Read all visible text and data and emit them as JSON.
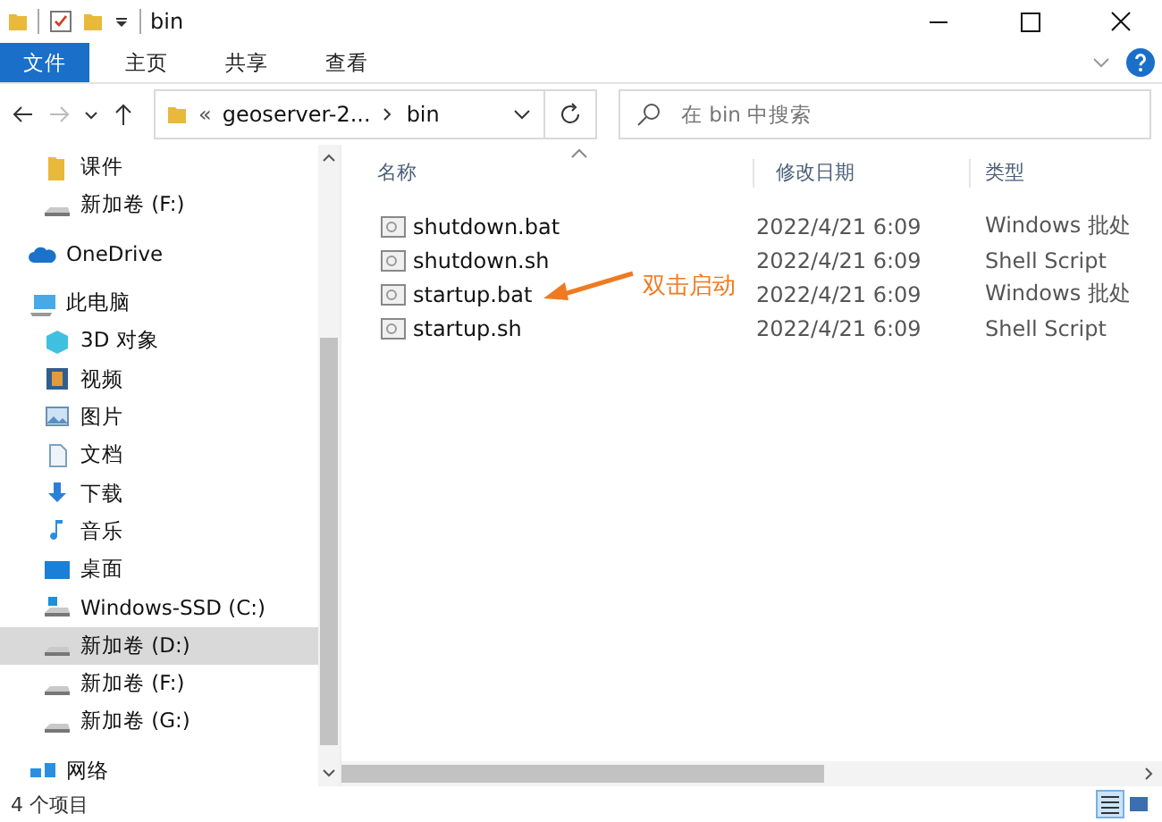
{
  "window": {
    "title": "bin"
  },
  "ribbon_tabs": [
    {
      "label": "文件",
      "selected": true
    },
    {
      "label": "主页",
      "selected": false
    },
    {
      "label": "共享",
      "selected": false
    },
    {
      "label": "查看",
      "selected": false
    }
  ],
  "address_bar": {
    "overflow": "«",
    "path": [
      "geoserver-2...",
      "bin"
    ],
    "forward_disabled": true
  },
  "search": {
    "placeholder": "在 bin 中搜索"
  },
  "nav_pane": {
    "quick_access": [
      {
        "label": "课件",
        "kind": "folder",
        "selected": false
      },
      {
        "label": "新加卷 (F:)",
        "kind": "drive",
        "selected": false
      }
    ],
    "items": [
      {
        "label": "OneDrive",
        "kind": "cloud",
        "selected": false
      },
      {
        "label": "此电脑",
        "kind": "pc",
        "selected": false,
        "children": [
          {
            "label": "3D 对象",
            "kind": "cube",
            "selected": false
          },
          {
            "label": "视频",
            "kind": "video",
            "selected": false
          },
          {
            "label": "图片",
            "kind": "image",
            "selected": false
          },
          {
            "label": "文档",
            "kind": "doc",
            "selected": false
          },
          {
            "label": "下载",
            "kind": "download",
            "selected": false
          },
          {
            "label": "音乐",
            "kind": "music",
            "selected": false
          },
          {
            "label": "桌面",
            "kind": "desktop",
            "selected": false
          },
          {
            "label": "Windows-SSD (C:)",
            "kind": "sysdrive",
            "selected": false
          },
          {
            "label": "新加卷 (D:)",
            "kind": "drive",
            "selected": true
          },
          {
            "label": "新加卷 (F:)",
            "kind": "drive",
            "selected": false
          },
          {
            "label": "新加卷 (G:)",
            "kind": "drive",
            "selected": false
          }
        ]
      },
      {
        "label": "网络",
        "kind": "network",
        "selected": false
      }
    ]
  },
  "table": {
    "columns": [
      "名称",
      "修改日期",
      "类型"
    ],
    "rows": [
      {
        "name": "shutdown.bat",
        "date": "2022/4/21 6:09",
        "type": "Windows 批处"
      },
      {
        "name": "shutdown.sh",
        "date": "2022/4/21 6:09",
        "type": "Shell Script"
      },
      {
        "name": "startup.bat",
        "date": "2022/4/21 6:09",
        "type": "Windows 批处",
        "annotation": "双击启动"
      },
      {
        "name": "startup.sh",
        "date": "2022/4/21 6:09",
        "type": "Shell Script"
      }
    ]
  },
  "status_bar": {
    "count": "4 个项目",
    "view_buttons": [
      {
        "kind": "details",
        "selected": true
      },
      {
        "kind": "tiles",
        "selected": false
      }
    ]
  }
}
